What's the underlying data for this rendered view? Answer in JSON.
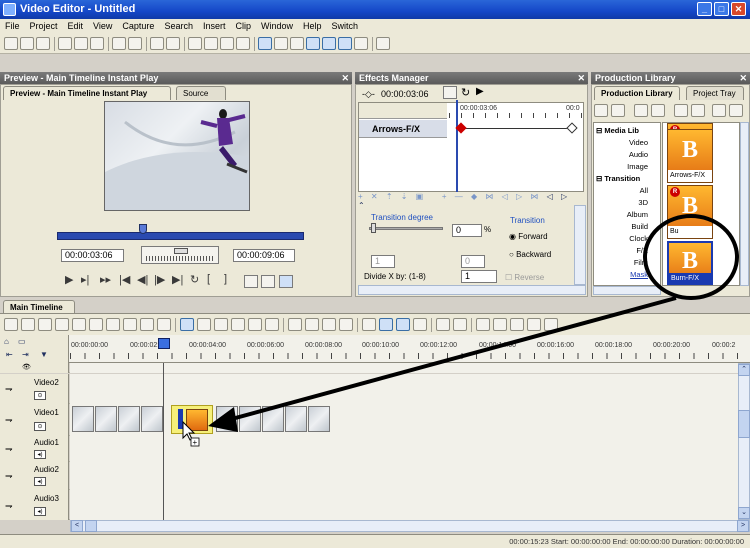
{
  "window": {
    "title": "Video Editor - Untitled"
  },
  "menu": [
    "File",
    "Project",
    "Edit",
    "View",
    "Capture",
    "Search",
    "Insert",
    "Clip",
    "Window",
    "Help",
    "Switch"
  ],
  "preview": {
    "panel_title": "Preview - Main Timeline Instant Play",
    "tabs": [
      "Preview - Main Timeline Instant Play",
      "Source"
    ],
    "timecode_left": "00:00:03:06",
    "timecode_right": "00:00:09:06"
  },
  "effects": {
    "panel_title": "Effects Manager",
    "timecode": "00:00:03:06",
    "ruler_start": "00:00:03:06",
    "ruler_end": "00:0",
    "track_label": "Arrows-F/X",
    "transition_degree_label": "Transition degree",
    "degree_value": "0",
    "degree_unit": "%",
    "transition_label": "Transition",
    "forward_label": "Forward",
    "backward_label": "Backward",
    "small_value_1": "1",
    "small_value_2": "0",
    "divide_label": "Divide X by: (1-8)",
    "divide_value": "1",
    "reverse_label": "Reverse"
  },
  "library": {
    "panel_title": "Production Library",
    "tabs": [
      "Production Library",
      "Project Tray"
    ],
    "tree": [
      {
        "label": "Media Lib",
        "header": true
      },
      {
        "label": "Video"
      },
      {
        "label": "Audio"
      },
      {
        "label": "Image"
      },
      {
        "label": "Transition",
        "header": true
      },
      {
        "label": "All"
      },
      {
        "label": "3D"
      },
      {
        "label": "Album"
      },
      {
        "label": "Build"
      },
      {
        "label": "Clock"
      },
      {
        "label": "F/X"
      },
      {
        "label": "Film"
      },
      {
        "label": "Mask"
      }
    ],
    "thumbs": [
      {
        "glyph": "B",
        "label": "",
        "badge": "R"
      },
      {
        "glyph": "B",
        "label": "Arrows-F/X",
        "badge": ""
      },
      {
        "glyph": "B",
        "label": "",
        "badge": "R"
      },
      {
        "glyph": "B",
        "label": "Bu",
        "badge": ""
      },
      {
        "glyph": "B",
        "label": "Burn-F/X",
        "badge": ""
      }
    ]
  },
  "timeline": {
    "tab_label": "Main Timeline",
    "ruler": [
      "00:00:00:00",
      "00:00:02:00",
      "00:00:04:00",
      "00:00:06:00",
      "00:00:08:00",
      "00:00:10:00",
      "00:00:12:00",
      "00:00:14:00",
      "00:00:16:00",
      "00:00:18:00",
      "00:00:20:00",
      "00:00:2"
    ],
    "tracks": [
      "Video2",
      "Video1",
      "Audio1",
      "Audio2",
      "Audio3"
    ]
  },
  "status": "00:00:15:23   Start: 00:00:00:00   End: 00:00:00:00   Duration: 00:00:00:00",
  "colors": {
    "title_bar": "#1447c8",
    "accent": "#f0a020",
    "annotation": "#000000"
  }
}
